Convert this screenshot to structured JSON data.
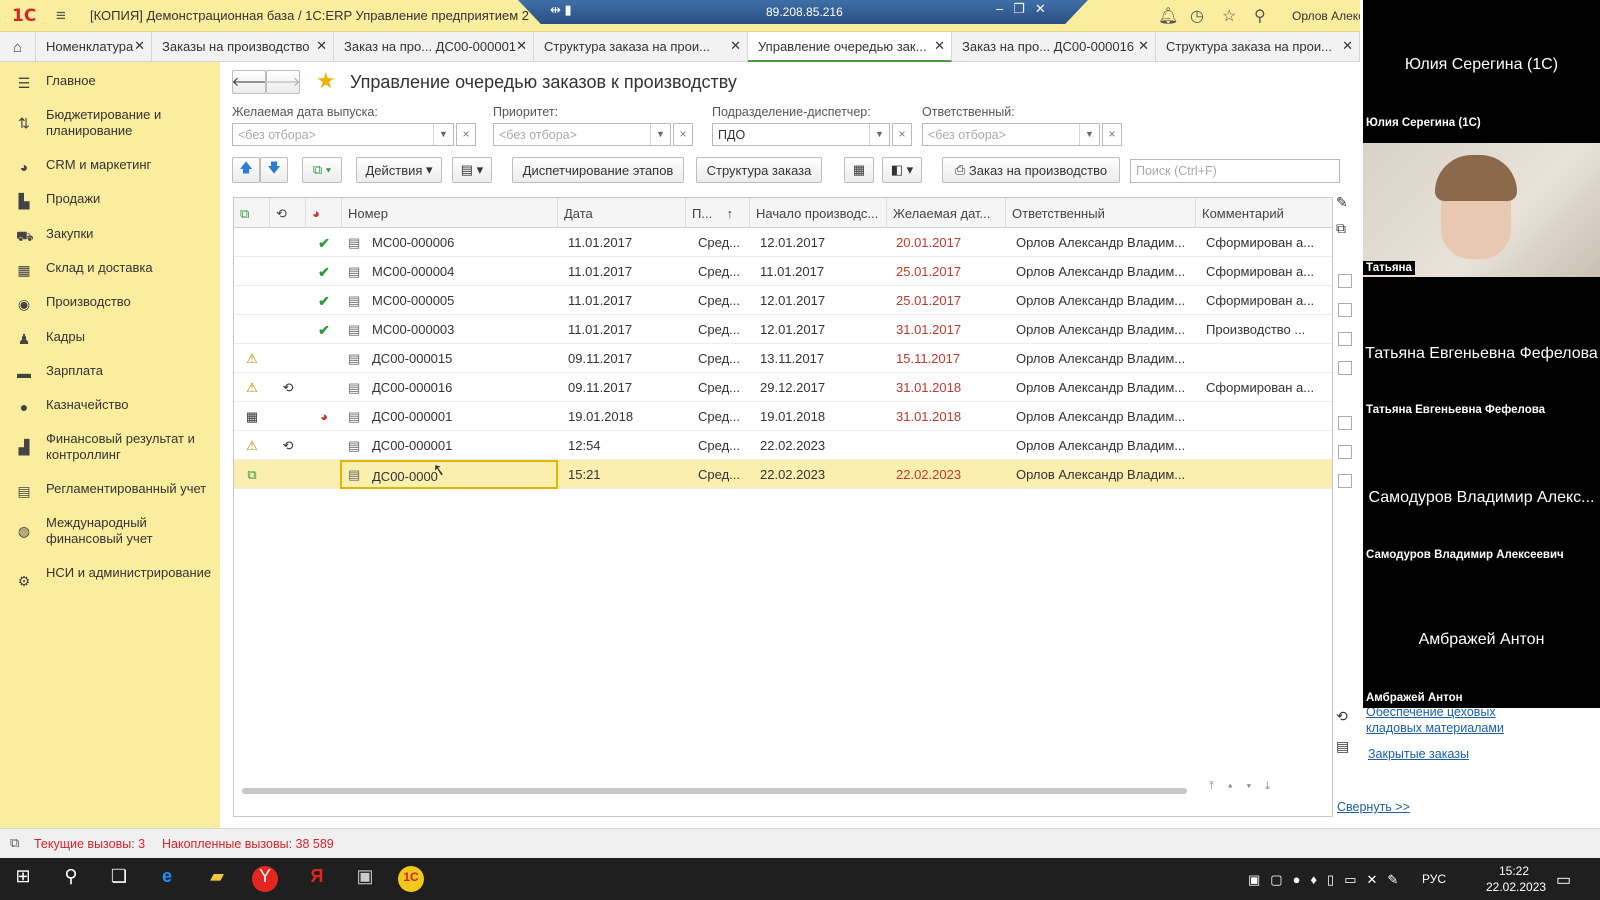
{
  "titlebar": {
    "logo": "1С",
    "app_title": "[КОПИЯ] Демонстрационная база / 1С:ERP Управление предприятием 2",
    "remote_ip": "89.208.85.216",
    "user": "Орлов Алекс"
  },
  "tabs": [
    {
      "label": "Номенклатура"
    },
    {
      "label": "Заказы на производство"
    },
    {
      "label": "Заказ на про... ДС00-000001"
    },
    {
      "label": "Структура заказа на прои..."
    },
    {
      "label": "Управление очередью зак..."
    },
    {
      "label": "Заказ на про... ДС00-000016"
    },
    {
      "label": "Структура заказа на прои..."
    }
  ],
  "sidebar": {
    "items": [
      {
        "label": "Главное",
        "icon": "menu-icon"
      },
      {
        "label": "Бюджетирование и планирование",
        "icon": "budget-icon"
      },
      {
        "label": "CRM и маркетинг",
        "icon": "crm-icon"
      },
      {
        "label": "Продажи",
        "icon": "sales-icon"
      },
      {
        "label": "Закупки",
        "icon": "cart-icon"
      },
      {
        "label": "Склад и доставка",
        "icon": "warehouse-icon"
      },
      {
        "label": "Производство",
        "icon": "production-icon"
      },
      {
        "label": "Кадры",
        "icon": "person-icon"
      },
      {
        "label": "Зарплата",
        "icon": "salary-icon"
      },
      {
        "label": "Казначейство",
        "icon": "treasury-icon"
      },
      {
        "label": "Финансовый результат и контроллинг",
        "icon": "chart-icon"
      },
      {
        "label": "Регламентированный учет",
        "icon": "ledger-icon"
      },
      {
        "label": "Международный финансовый учет",
        "icon": "globe-icon"
      },
      {
        "label": "НСИ и администрирование",
        "icon": "gear-icon"
      }
    ]
  },
  "page": {
    "title": "Управление очередью заказов к производству"
  },
  "filters": {
    "date_label": "Желаемая дата выпуска:",
    "date_value": "<без отбора>",
    "priority_label": "Приоритет:",
    "priority_value": "<без отбора>",
    "dept_label": "Подразделение-диспетчер:",
    "dept_value": "ПДО",
    "resp_label": "Ответственный:",
    "resp_value": "<без отбора>"
  },
  "toolbar": {
    "actions": "Действия",
    "dispatch": "Диспетчирование этапов",
    "structure": "Структура заказа",
    "order": "Заказ на производство",
    "search_placeholder": "Поиск (Ctrl+F)"
  },
  "grid": {
    "columns": [
      "Номер",
      "Дата",
      "П...",
      "Начало производс...",
      "Желаемая дат...",
      "Ответственный",
      "Комментарий"
    ],
    "rows": [
      {
        "num": "МС00-000006",
        "date": "11.01.2017",
        "prio": "Сред...",
        "start": "12.01.2017",
        "want": "20.01.2017",
        "resp": "Орлов Александр Владим...",
        "comment": "Сформирован а..."
      },
      {
        "num": "МС00-000004",
        "date": "11.01.2017",
        "prio": "Сред...",
        "start": "11.01.2017",
        "want": "25.01.2017",
        "resp": "Орлов Александр Владим...",
        "comment": "Сформирован а..."
      },
      {
        "num": "МС00-000005",
        "date": "11.01.2017",
        "prio": "Сред...",
        "start": "12.01.2017",
        "want": "25.01.2017",
        "resp": "Орлов Александр Владим...",
        "comment": "Сформирован а..."
      },
      {
        "num": "МС00-000003",
        "date": "11.01.2017",
        "prio": "Сред...",
        "start": "12.01.2017",
        "want": "31.01.2017",
        "resp": "Орлов Александр Владим...",
        "comment": "Производство ..."
      },
      {
        "num": "ДС00-000015",
        "date": "09.11.2017",
        "prio": "Сред...",
        "start": "13.11.2017",
        "want": "15.11.2017",
        "resp": "Орлов Александр Владим...",
        "comment": ""
      },
      {
        "num": "ДС00-000016",
        "date": "09.11.2017",
        "prio": "Сред...",
        "start": "29.12.2017",
        "want": "31.01.2018",
        "resp": "Орлов Александр Владим...",
        "comment": "Сформирован а..."
      },
      {
        "num": "ДС00-000001",
        "date": "19.01.2018",
        "prio": "Сред...",
        "start": "19.01.2018",
        "want": "31.01.2018",
        "resp": "Орлов Александр Владим...",
        "comment": ""
      },
      {
        "num": "ДС00-000001",
        "date": "12:54",
        "prio": "Сред...",
        "start": "22.02.2023",
        "want": "",
        "resp": "Орлов Александр Владим...",
        "comment": ""
      },
      {
        "num": "ДС00-0000",
        "date": "15:21",
        "prio": "Сред...",
        "start": "22.02.2023",
        "want": "22.02.2023",
        "resp": "Орлов Александр Владим...",
        "comment": ""
      }
    ]
  },
  "right_panel": {
    "link1": "Обеспечение цеховых кладовых материалами",
    "link2": "Закрытые заказы",
    "collapse": "Свернуть >>"
  },
  "videos": [
    {
      "name": "Юлия Серегина (1С)",
      "label": "Юлия Серегина (1С)"
    },
    {
      "name": "",
      "label": "Татьяна"
    },
    {
      "name": "Татьяна Евгеньевна Фефелова",
      "label": "Татьяна Евгеньевна Фефелова"
    },
    {
      "name": "Самодуров Владимир Алекс...",
      "label": "Самодуров Владимир Алексеевич"
    },
    {
      "name": "Амбражей Антон",
      "label": "Амбражей Антон"
    }
  ],
  "status": {
    "current": "Текущие вызовы: 3",
    "accum": "Накопленные вызовы: 38 589"
  },
  "taskbar": {
    "lang": "РУС",
    "time": "15:22",
    "date": "22.02.2023"
  }
}
